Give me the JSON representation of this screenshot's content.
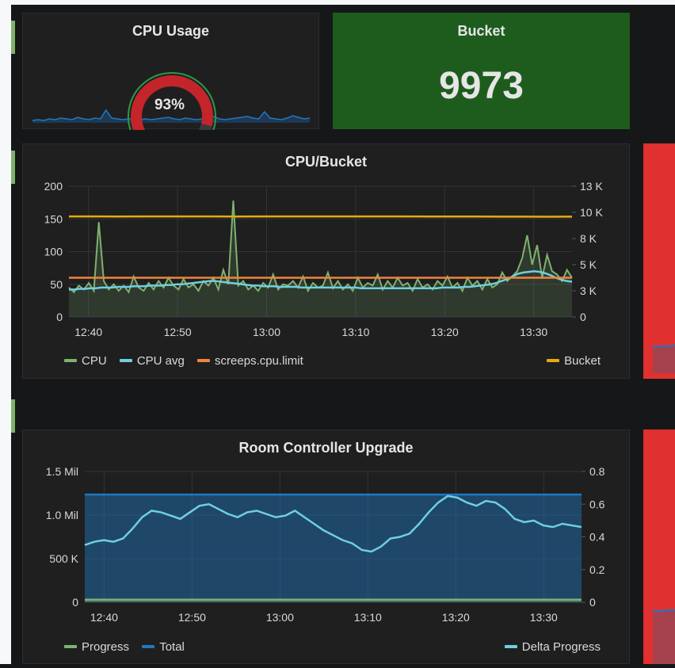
{
  "colors": {
    "background": "#161719",
    "panel": "#1f1f20",
    "cpu": "#7eb26d",
    "cpu_avg": "#6ed0e0",
    "limit": "#ef843c",
    "bucket": "#e5ac0e",
    "total": "#1f78c1",
    "progress": "#7eb26d",
    "delta": "#6ed0e0",
    "gauge_red": "#d44a3a",
    "bucket_bg": "#1e5c1e",
    "red_panel": "#e0302f",
    "row_marker": "#7eb26d"
  },
  "cpu_panel": {
    "title": "CPU Usage",
    "value": "93%",
    "gauge_fraction": 0.93,
    "icon": "gauge-icon"
  },
  "bucket_panel": {
    "title": "Bucket",
    "value": "9973"
  },
  "cpu_bucket_panel": {
    "title": "CPU/Bucket",
    "legend": [
      {
        "name": "CPU",
        "color": "#7eb26d"
      },
      {
        "name": "CPU avg",
        "color": "#6ed0e0"
      },
      {
        "name": "screeps.cpu.limit",
        "color": "#ef843c"
      }
    ],
    "legend_right": {
      "name": "Bucket",
      "color": "#e5ac0e"
    }
  },
  "room_panel": {
    "title": "Room Controller Upgrade",
    "legend": [
      {
        "name": "Progress",
        "color": "#7eb26d"
      },
      {
        "name": "Total",
        "color": "#1f78c1"
      }
    ],
    "legend_right": {
      "name": "Delta Progress",
      "color": "#6ed0e0"
    }
  },
  "chart_data": [
    {
      "type": "line",
      "title": "CPU/Bucket",
      "x_ticks": [
        "12:40",
        "12:50",
        "13:00",
        "13:10",
        "13:20",
        "13:30"
      ],
      "y_left_ticks": [
        "0",
        "50",
        "100",
        "150",
        "200"
      ],
      "y_right_ticks": [
        "0",
        "3 K",
        "5 K",
        "8 K",
        "10 K",
        "13 K"
      ],
      "ylim_left": [
        0,
        200
      ],
      "ylim_right": [
        0,
        13000
      ],
      "grid": true,
      "legend_position": "bottom",
      "series": [
        {
          "name": "CPU",
          "axis": "left",
          "values": [
            45,
            38,
            48,
            42,
            52,
            40,
            145,
            55,
            42,
            50,
            40,
            48,
            38,
            62,
            45,
            40,
            52,
            42,
            55,
            45,
            60,
            48,
            42,
            58,
            45,
            50,
            40,
            55,
            48,
            60,
            42,
            72,
            50,
            178,
            48,
            55,
            42,
            48,
            40,
            52,
            45,
            65,
            42,
            50,
            48,
            55,
            45,
            62,
            40,
            52,
            45,
            48,
            68,
            44,
            55,
            42,
            50,
            40,
            60,
            45,
            52,
            48,
            65,
            42,
            55,
            45,
            60,
            48,
            52,
            40,
            58,
            45,
            50,
            42,
            55,
            48,
            62,
            45,
            52,
            40,
            60,
            48,
            55,
            42,
            58,
            45,
            50,
            68,
            55,
            62,
            70,
            90,
            125,
            80,
            110,
            60,
            95,
            70,
            65,
            55,
            72,
            60
          ]
        },
        {
          "name": "CPU avg",
          "axis": "left",
          "values": [
            42,
            42,
            43,
            43,
            44,
            44,
            45,
            45,
            45,
            46,
            46,
            46,
            47,
            47,
            47,
            48,
            48,
            48,
            49,
            49,
            50,
            50,
            51,
            52,
            53,
            54,
            55,
            55,
            54,
            53,
            52,
            51,
            50,
            49,
            48,
            48,
            47,
            47,
            47,
            46,
            46,
            46,
            46,
            45,
            45,
            45,
            45,
            45,
            45,
            45,
            45,
            45,
            45,
            45,
            44,
            44,
            44,
            44,
            44,
            44,
            44,
            44,
            44,
            44,
            44,
            44,
            44,
            44,
            44,
            45,
            45,
            45,
            45,
            46,
            46,
            47,
            48,
            49,
            50,
            52,
            55,
            58,
            62,
            66,
            68,
            69,
            70,
            69,
            67,
            64,
            60,
            57,
            55,
            54
          ]
        },
        {
          "name": "screeps.cpu.limit",
          "axis": "left",
          "values": [
            60,
            60
          ]
        },
        {
          "name": "Bucket",
          "axis": "right",
          "values": [
            10000,
            10000,
            9990,
            10000,
            9995,
            10000,
            10000,
            9990,
            10000,
            10000,
            10000,
            9995,
            10000,
            10000,
            10000,
            9990,
            9990,
            9985,
            9980,
            9975,
            9970,
            9973
          ]
        }
      ]
    },
    {
      "type": "area",
      "title": "Room Controller Upgrade",
      "x_ticks": [
        "12:40",
        "12:50",
        "13:00",
        "13:10",
        "13:20",
        "13:30"
      ],
      "y_left_ticks": [
        "0",
        "500 K",
        "1.0 Mil",
        "1.5 Mil"
      ],
      "y_right_ticks": [
        "0",
        "0.2",
        "0.4",
        "0.6",
        "0.8"
      ],
      "ylim_left": [
        0,
        1500000
      ],
      "ylim_right": [
        0,
        0.8
      ],
      "grid": true,
      "legend_position": "bottom",
      "series": [
        {
          "name": "Progress",
          "axis": "left",
          "values": [
            30000,
            30000
          ]
        },
        {
          "name": "Total",
          "axis": "left",
          "values": [
            1235000,
            1235000
          ]
        },
        {
          "name": "Delta Progress",
          "axis": "right",
          "values": [
            0.35,
            0.37,
            0.38,
            0.37,
            0.39,
            0.45,
            0.52,
            0.56,
            0.55,
            0.53,
            0.51,
            0.55,
            0.59,
            0.6,
            0.57,
            0.54,
            0.52,
            0.55,
            0.56,
            0.54,
            0.52,
            0.53,
            0.56,
            0.52,
            0.48,
            0.44,
            0.41,
            0.38,
            0.36,
            0.32,
            0.31,
            0.34,
            0.39,
            0.4,
            0.42,
            0.48,
            0.55,
            0.61,
            0.65,
            0.64,
            0.61,
            0.59,
            0.62,
            0.61,
            0.57,
            0.51,
            0.49,
            0.5,
            0.47,
            0.46,
            0.48,
            0.47,
            0.46
          ]
        }
      ]
    }
  ]
}
